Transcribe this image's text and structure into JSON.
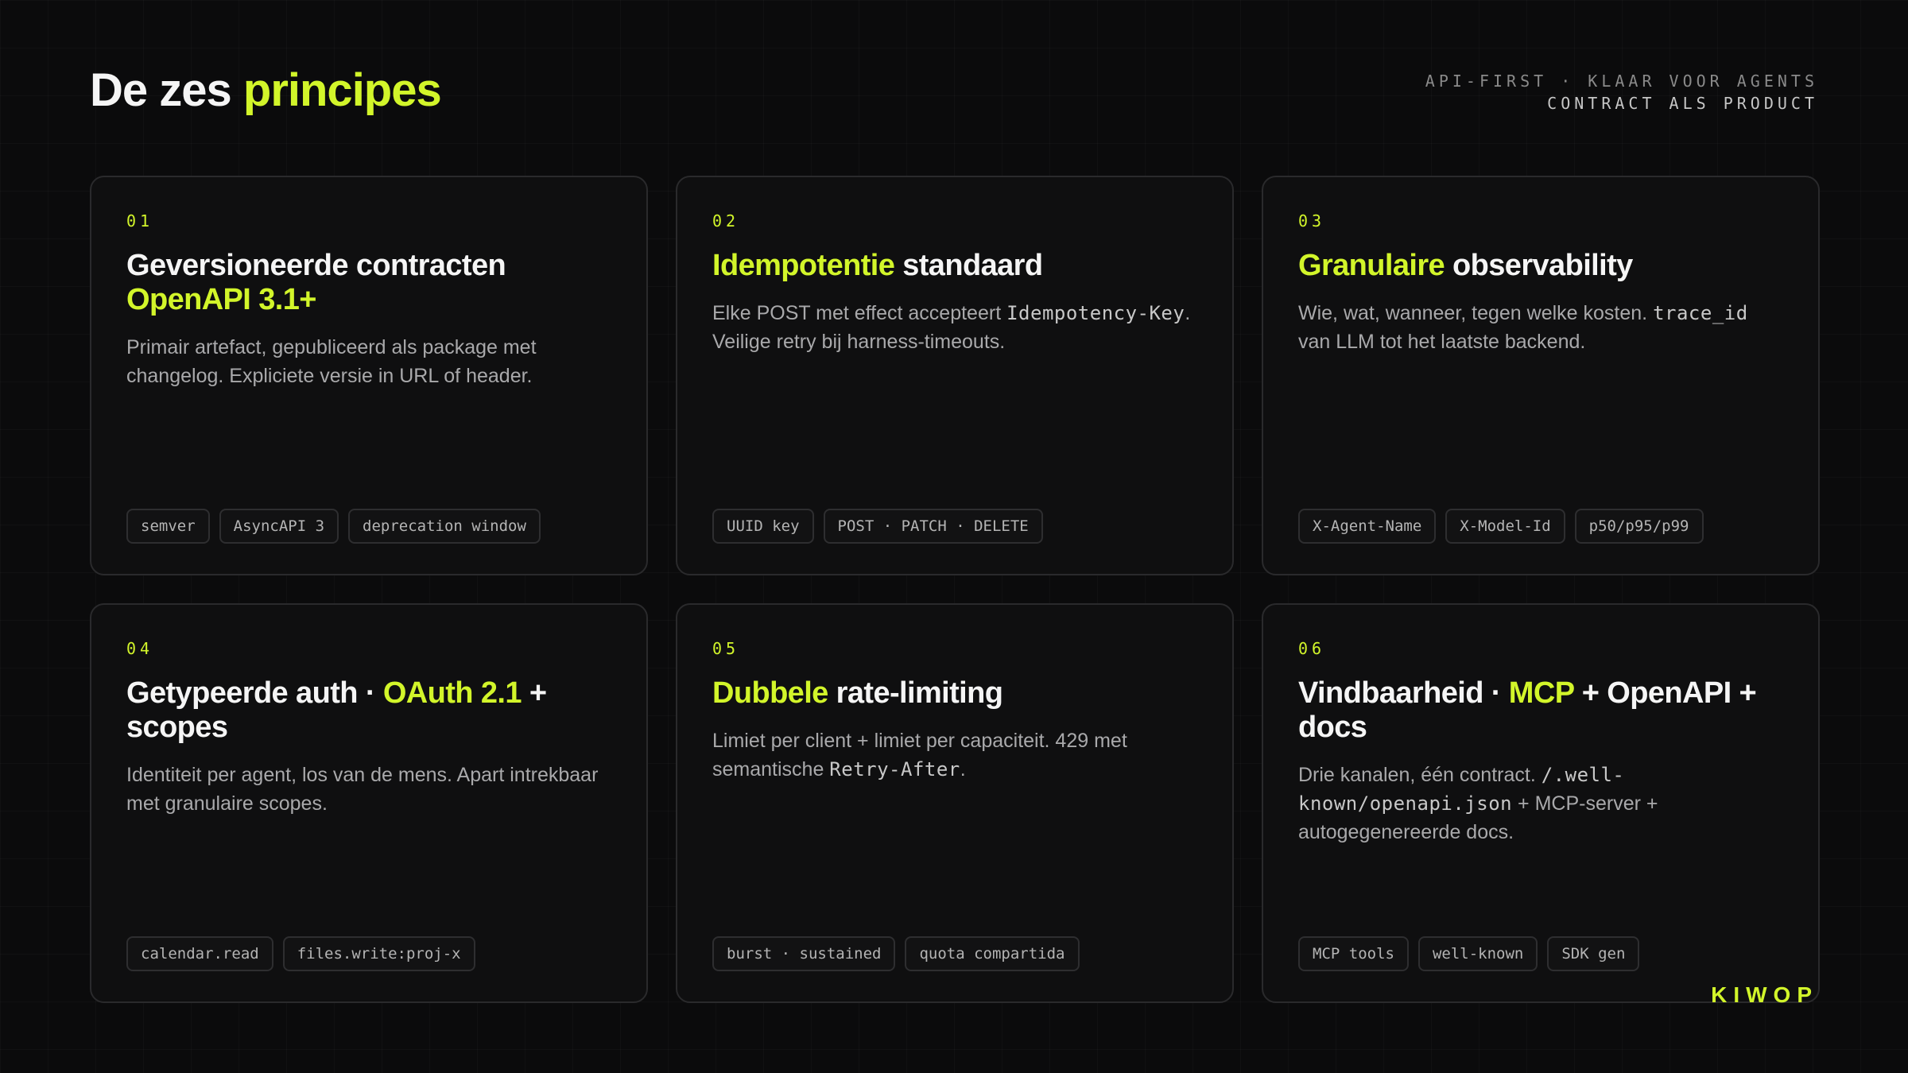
{
  "header": {
    "title_prefix": "De zes ",
    "title_accent": "principes",
    "meta_line1": "API-FIRST · KLAAR VOOR AGENTS",
    "meta_line2": "CONTRACT ALS PRODUCT"
  },
  "cards": [
    {
      "num": "01",
      "title_a": "Geversioneerde contracten ",
      "title_b": "OpenAPI 3.1+",
      "title_c": "",
      "desc_1": "Primair artefact, gepubliceerd als package met changelog. Expliciete versie in URL of header.",
      "code_1": "",
      "desc_2": "",
      "tags": [
        "semver",
        "AsyncAPI 3",
        "deprecation window"
      ]
    },
    {
      "num": "02",
      "title_a": "",
      "title_b": "Idempotentie",
      "title_c": " standaard",
      "desc_1": "Elke POST met effect accepteert ",
      "code_1": "Idempotency-Key",
      "desc_2": ". Veilige retry bij harness-timeouts.",
      "tags": [
        "UUID key",
        "POST · PATCH · DELETE"
      ]
    },
    {
      "num": "03",
      "title_a": "",
      "title_b": "Granulaire",
      "title_c": " observability",
      "desc_1": "Wie, wat, wanneer, tegen welke kosten. ",
      "code_1": "trace_id",
      "desc_2": " van LLM tot het laatste backend.",
      "tags": [
        "X-Agent-Name",
        "X-Model-Id",
        "p50/p95/p99"
      ]
    },
    {
      "num": "04",
      "title_a": "Getypeerde auth · ",
      "title_b": "OAuth 2.1",
      "title_c": " + scopes",
      "desc_1": "Identiteit per agent, los van de mens. Apart intrekbaar met granulaire scopes.",
      "code_1": "",
      "desc_2": "",
      "tags": [
        "calendar.read",
        "files.write:proj-x"
      ]
    },
    {
      "num": "05",
      "title_a": "",
      "title_b": "Dubbele",
      "title_c": " rate-limiting",
      "desc_1": "Limiet per client + limiet per capaciteit. 429 met semantische ",
      "code_1": "Retry-After",
      "desc_2": ".",
      "tags": [
        "burst · sustained",
        "quota compartida"
      ]
    },
    {
      "num": "06",
      "title_a": "Vindbaarheid · ",
      "title_b": "MCP",
      "title_c": " + OpenAPI + docs",
      "desc_1": "Drie kanalen, één contract. ",
      "code_1": "/.well-known/openapi.json",
      "desc_2": " + MCP-server + autogegenereerde docs.",
      "tags": [
        "MCP tools",
        "well-known",
        "SDK gen"
      ]
    }
  ],
  "brand": "KIWOP",
  "colors": {
    "accent": "#d2f52a",
    "background": "#0b0b0c",
    "card_border": "#2a2a2c"
  }
}
